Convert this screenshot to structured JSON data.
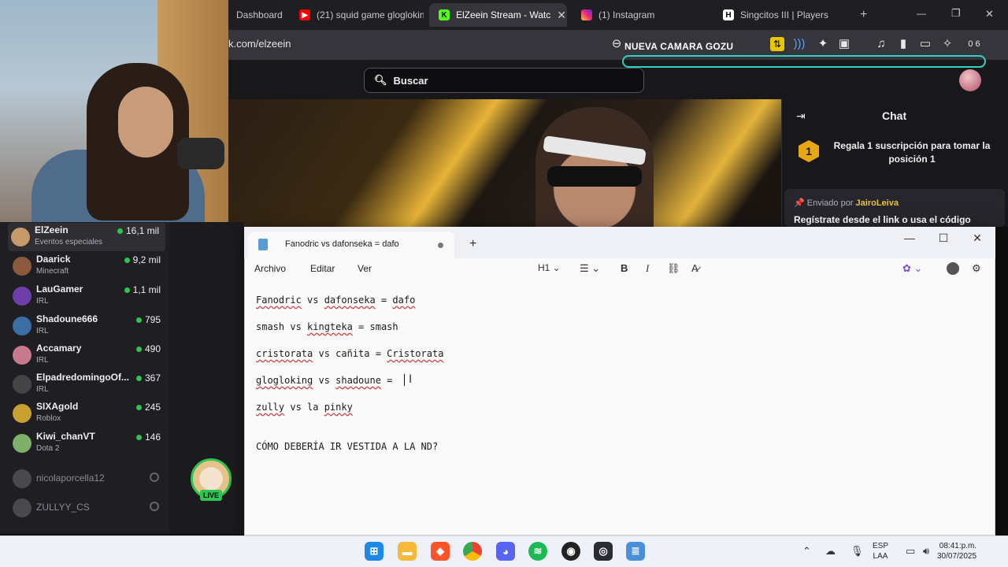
{
  "browser": {
    "tabs": [
      {
        "label": "Dashboard",
        "icon": "dashboard-icon"
      },
      {
        "label": "(21) squid game glogloking",
        "icon": "youtube-icon"
      },
      {
        "label": "ElZeein Stream - Watc",
        "icon": "kick-icon"
      },
      {
        "label": "(1) Instagram",
        "icon": "instagram-icon"
      },
      {
        "label": "Singcitos III | Players",
        "icon": "h-icon"
      }
    ],
    "url": "k.com/elzeein",
    "new_tab": "+",
    "window_min": "—",
    "window_max": "❐",
    "window_close": "✕",
    "camera_notice": "NUEVA CAMARA GOZU",
    "counter": "0 6"
  },
  "twitch": {
    "search_placeholder": "Buscar"
  },
  "chat": {
    "title": "Chat",
    "gift_badge": "1",
    "gift_text": "Regala 1 suscripción para tomar la posición 1",
    "pinned_prefix": "Enviado por",
    "pinned_user": "JairoLeiva",
    "pinned_text": "Regístrate desde el link o usa el código"
  },
  "sidebar": {
    "channels": [
      {
        "name": "ElZeein",
        "category": "Eventos especiales",
        "viewers": "16,1 mil",
        "color": "#c79a6a"
      },
      {
        "name": "Daarick",
        "category": "Minecraft",
        "viewers": "9,2 mil",
        "color": "#8b5a3c"
      },
      {
        "name": "LauGamer",
        "category": "IRL",
        "viewers": "1,1 mil",
        "color": "#6e3fa8"
      },
      {
        "name": "Shadoune666",
        "category": "IRL",
        "viewers": "795",
        "color": "#3a6ea5"
      },
      {
        "name": "Accamary",
        "category": "IRL",
        "viewers": "490",
        "color": "#c77a8e"
      },
      {
        "name": "ElpadredomingoOf...",
        "category": "IRL",
        "viewers": "367",
        "color": "#444"
      },
      {
        "name": "SIXAgold",
        "category": "Roblox",
        "viewers": "245",
        "color": "#c9a132"
      },
      {
        "name": "Kiwi_chanVT",
        "category": "Dota 2",
        "viewers": "146",
        "color": "#7fb069"
      }
    ],
    "offline": [
      {
        "name": "nicolaporcella12"
      },
      {
        "name": "ZULLYY_CS"
      }
    ],
    "live_badge": "LIVE"
  },
  "notepad": {
    "tab_title": "Fanodric vs dafonseka = dafo",
    "menu": [
      "Archivo",
      "Editar",
      "Ver"
    ],
    "heading_select": "H1",
    "lines": [
      "Fanodric vs dafonseka = dafo",
      "smash vs kingteka = smash",
      "cristorata vs cañita = Cristorata",
      "glogloking vs shadoune = ",
      "zully vs la pinky",
      "CÓMO DEBERÍA IR VESTIDA A LA ND?"
    ]
  },
  "taskbar": {
    "lang_top": "ESP",
    "lang_bottom": "LAA",
    "time": "08:41:p.m.",
    "date": "30/07/2025"
  }
}
